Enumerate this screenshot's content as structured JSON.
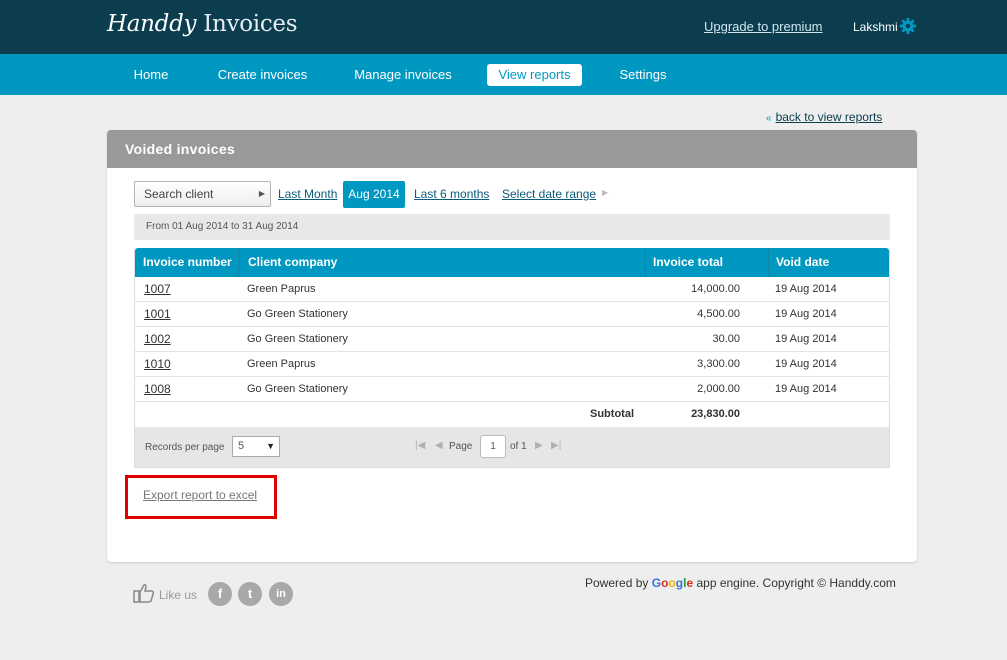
{
  "header": {
    "logo_script": "Handdy",
    "logo_plain": "Invoices",
    "upgrade_label": "Upgrade to premium",
    "user_name": "Lakshmi"
  },
  "nav": {
    "items": [
      {
        "label": "Home"
      },
      {
        "label": "Create invoices"
      },
      {
        "label": "Manage invoices"
      },
      {
        "label": "View reports"
      },
      {
        "label": "Settings"
      }
    ],
    "active": "View reports"
  },
  "back_link": "back to view reports",
  "panel": {
    "title": "Voided invoices",
    "search_placeholder": "Search client",
    "filters": {
      "last_month": "Last Month",
      "active": "Aug 2014",
      "last_6_months": "Last 6 months",
      "date_range": "Select date range"
    },
    "range_text": "From 01 Aug 2014 to 31 Aug 2014"
  },
  "table": {
    "headers": [
      "Invoice number",
      "Client company",
      "Invoice total",
      "Void date"
    ],
    "rows": [
      {
        "number": "1007",
        "client": "Green Paprus",
        "total": "14,000.00",
        "date": "19 Aug 2014"
      },
      {
        "number": "1001",
        "client": "Go Green Stationery",
        "total": "4,500.00",
        "date": "19 Aug 2014"
      },
      {
        "number": "1002",
        "client": "Go Green Stationery",
        "total": "30.00",
        "date": "19 Aug 2014"
      },
      {
        "number": "1010",
        "client": "Green Paprus",
        "total": "3,300.00",
        "date": "19 Aug 2014"
      },
      {
        "number": "1008",
        "client": "Go Green Stationery",
        "total": "2,000.00",
        "date": "19 Aug 2014"
      }
    ],
    "subtotal_label": "Subtotal",
    "subtotal_value": "23,830.00"
  },
  "pager": {
    "records_label": "Records per page",
    "records_value": "5",
    "page_label": "Page",
    "page_value": "1",
    "of_label": "of 1"
  },
  "export_label": "Export report to excel",
  "footer": {
    "like_label": "Like us",
    "social": [
      "f",
      "t",
      "in"
    ],
    "powered_prefix": "Powered by",
    "google_letters": [
      "G",
      "o",
      "o",
      "g",
      "l",
      "e"
    ],
    "powered_suffix": "app engine. Copyright © Handdy.com"
  },
  "colors": {
    "header_bg": "#0b3d4f",
    "nav_bg": "#0098c0",
    "accent": "#0098c0",
    "panel_head": "#999999",
    "highlight_box": "#e00000"
  },
  "icons": [
    "gear-icon",
    "double-left-arrow-icon",
    "chevron-right-icon",
    "caret-down-icon",
    "first-page-icon",
    "prev-page-icon",
    "next-page-icon",
    "last-page-icon",
    "thumbs-up-icon",
    "facebook-icon",
    "twitter-icon",
    "linkedin-icon"
  ]
}
